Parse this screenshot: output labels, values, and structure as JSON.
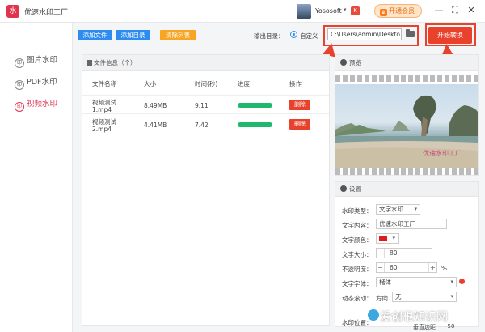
{
  "app": {
    "title": "优速水印工厂",
    "logo_glyph": "水",
    "username": "Yososoft",
    "badge": "K",
    "vip_label": "开通会员",
    "window_controls": [
      "—",
      "⛶",
      "✕"
    ]
  },
  "sidebar": {
    "items": [
      {
        "label": "图片水印",
        "icon": "印",
        "active": false
      },
      {
        "label": "PDF水印",
        "icon": "印",
        "active": false
      },
      {
        "label": "视频水印",
        "icon": "印",
        "active": true
      }
    ]
  },
  "toolbar": {
    "add_file": "添加文件",
    "add_dir": "添加目录",
    "clear_list": "清除列表",
    "output_label": "输出目录：",
    "custom_label": "自定义",
    "output_path": "C:\\Users\\admin\\Deskto",
    "start_label": "开始转换"
  },
  "annotations": {
    "num1": "1",
    "num2": "2",
    "color": "#e8412c"
  },
  "file_panel": {
    "title": "文件信息（个）",
    "columns": [
      "文件名称",
      "大小",
      "时间(秒)",
      "进度",
      "操作"
    ],
    "rows": [
      {
        "name": "视频测试1.mp4",
        "size": "8.49MB",
        "time": "9.11",
        "progress": 1.0,
        "action": "删除"
      },
      {
        "name": "视频测试2.mp4",
        "size": "4.41MB",
        "time": "7.42",
        "progress": 1.0,
        "action": "删除"
      }
    ]
  },
  "preview": {
    "title": "预览",
    "watermark": "优速水印工厂"
  },
  "settings": {
    "title": "设置",
    "type_label": "水印类型：",
    "type_value": "文字水印",
    "content_label": "文字内容：",
    "content_value": "优速水印工厂",
    "color_label": "文字颜色：",
    "color_value": "#e01a1a",
    "size_label": "文字大小：",
    "size_value": "80",
    "opacity_label": "不透明度：",
    "opacity_value": "60",
    "opacity_unit": "%",
    "font_label": "文字字体：",
    "font_value": "楷体",
    "motion_label": "动态滚动：",
    "motion_dir": "方向",
    "motion_value": "无",
    "position_label": "水印位置：",
    "margin_label": "垂直边距",
    "margin_value": "-50"
  },
  "site_watermark": "爱创根知识网"
}
